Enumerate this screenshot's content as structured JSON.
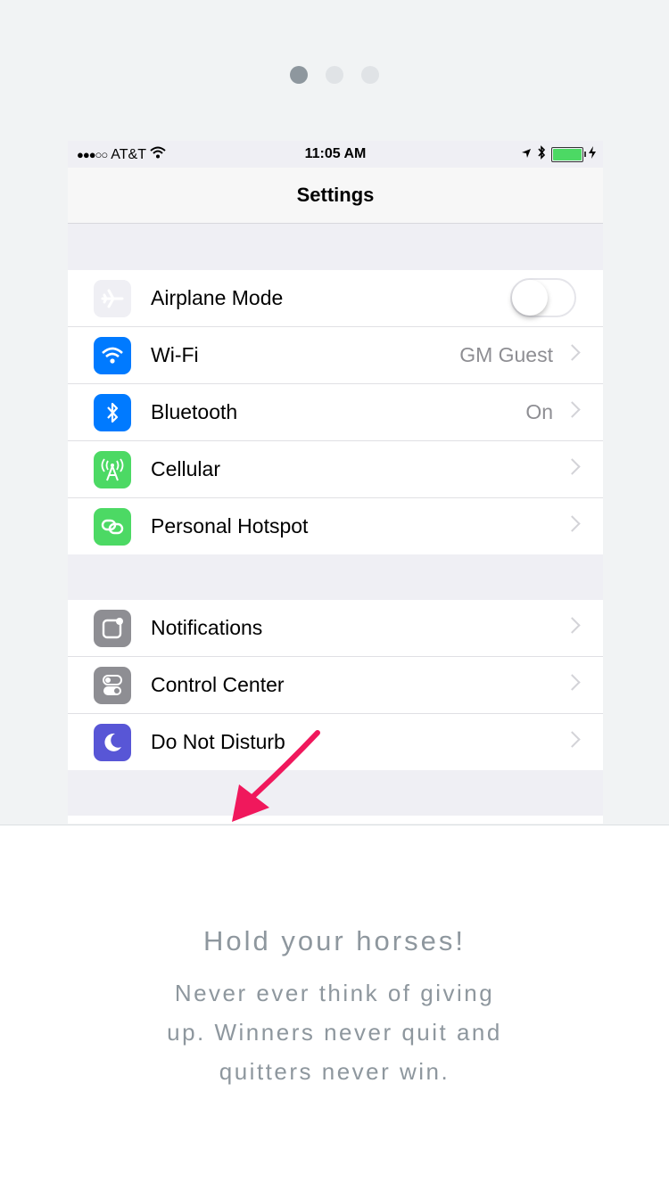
{
  "pager": {
    "dots": 3,
    "active": 0
  },
  "status_bar": {
    "signal": "●●●○○",
    "carrier": "AT&T",
    "time": "11:05 AM"
  },
  "nav": {
    "title": "Settings"
  },
  "groups": [
    {
      "rows": [
        {
          "label": "Airplane Mode",
          "icon": "airplane-icon",
          "icon_color": "#efeff4",
          "toggle": false
        },
        {
          "label": "Wi-Fi",
          "icon": "wifi-icon",
          "icon_color": "#007aff",
          "value": "GM Guest"
        },
        {
          "label": "Bluetooth",
          "icon": "bluetooth-icon",
          "icon_color": "#007aff",
          "value": "On"
        },
        {
          "label": "Cellular",
          "icon": "cellular-icon",
          "icon_color": "#4cd964",
          "value": ""
        },
        {
          "label": "Personal Hotspot",
          "icon": "hotspot-icon",
          "icon_color": "#4cd964",
          "value": ""
        }
      ]
    },
    {
      "rows": [
        {
          "label": "Notifications",
          "icon": "notifications-icon",
          "icon_color": "#8e8e93"
        },
        {
          "label": "Control Center",
          "icon": "control-center-icon",
          "icon_color": "#8e8e93"
        },
        {
          "label": "Do Not Disturb",
          "icon": "moon-icon",
          "icon_color": "#5856d6"
        }
      ]
    }
  ],
  "card": {
    "title": "Hold your horses!",
    "message": "Never ever think of giving up. Winners never quit and quitters never win."
  },
  "colors": {
    "arrow": "#f0185c",
    "text_muted": "#8e979e"
  }
}
